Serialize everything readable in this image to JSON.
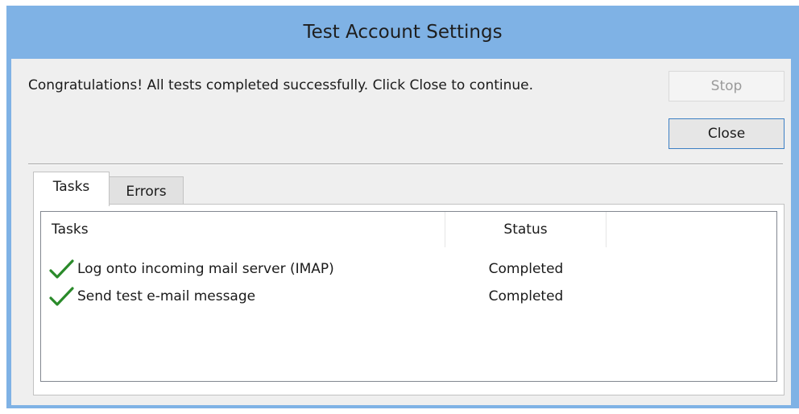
{
  "window": {
    "title": "Test Account Settings"
  },
  "message": {
    "text": "Congratulations! All tests completed successfully. Click Close to continue."
  },
  "buttons": {
    "stop_label": "Stop",
    "close_label": "Close"
  },
  "tabs": [
    {
      "label": "Tasks",
      "selected": true
    },
    {
      "label": "Errors",
      "selected": false
    }
  ],
  "table": {
    "columns": [
      "Tasks",
      "Status"
    ],
    "rows": [
      {
        "icon": "checkmark-icon",
        "task": "Log onto incoming mail server (IMAP)",
        "status": "Completed"
      },
      {
        "icon": "checkmark-icon",
        "task": "Send test e-mail message",
        "status": "Completed"
      }
    ]
  },
  "colors": {
    "title_bar": "#7fb2e5",
    "check": "#2a8a2a",
    "button_focus_border": "#3c7fc4"
  }
}
